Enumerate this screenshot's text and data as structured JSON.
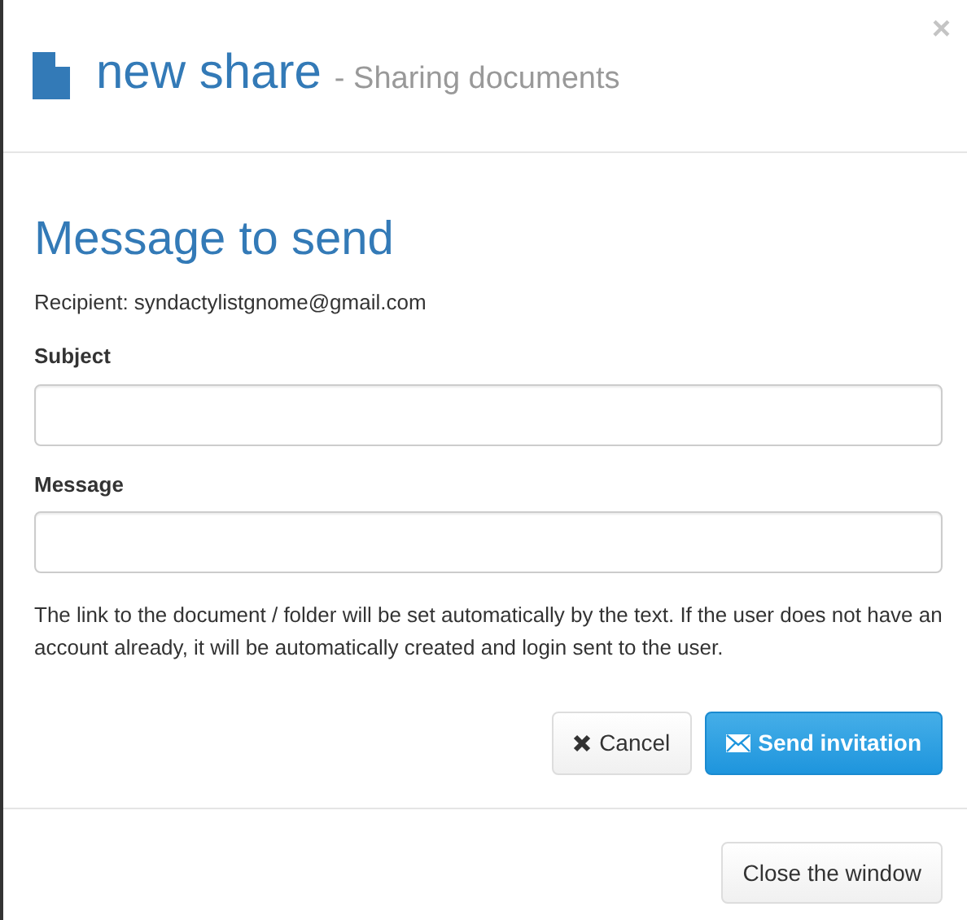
{
  "header": {
    "close": "×",
    "title": "new share",
    "subtitle": "- Sharing documents"
  },
  "form": {
    "heading": "Message to send",
    "recipient": "Recipient: syndactylistgnome@gmail.com",
    "fields": [
      {
        "label": "Subject"
      },
      {
        "label": "Message"
      }
    ],
    "help": "The link to the document / folder will be set automatically by the text. If the user does not have an account already, it will be automatically created and login sent to the user.",
    "buttons": [
      {
        "label": "Cancel",
        "kind": "cancel"
      },
      {
        "label": "Send invitation",
        "kind": "send"
      }
    ]
  },
  "footer": {
    "button": "Close the window"
  }
}
